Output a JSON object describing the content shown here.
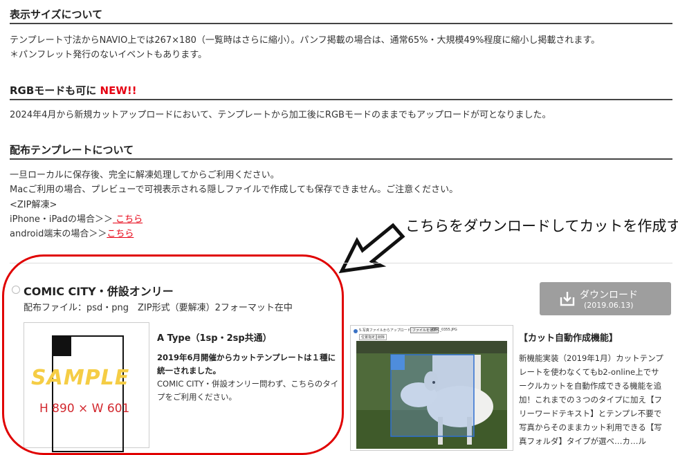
{
  "sections": {
    "size": {
      "heading": "表示サイズについて",
      "line1": "テンプレート寸法からNAVIO上では267×180（一覧時はさらに縮小）。パンフ掲載の場合は、通常65%・大規模49%程度に縮小し掲載されます。",
      "line2": "＊パンフレット発行のないイベントもあります。"
    },
    "rgb": {
      "heading": "RGBモードも可に",
      "badge": "NEW!!",
      "line1": "2024年4月から新規カットアップロードにおいて、テンプレートから加工後にRGBモードのままでもアップロードが可となりました。"
    },
    "template": {
      "heading": "配布テンプレートについて",
      "line1": "一旦ローカルに保存後、完全に解凍処理してからご利用ください。",
      "line2": "Macご利用の場合、プレビューで可視表示される隠しファイルで作成しても保存できません。ご注意ください。",
      "line3": "<ZIP解凍>",
      "iphone_label": "iPhone・iPadの場合＞＞",
      "iphone_link": " こちら",
      "android_label": "android端末の場合＞＞",
      "android_link": "こちら"
    }
  },
  "annotation": {
    "text": "こちらをダウンロードしてカットを作成する",
    "circle_color": "#e00000"
  },
  "event": {
    "title": "COMIC CITY・併設オンリー",
    "files": "配布ファイル：psd・png　ZIP形式（要解凍）2フォーマット在中",
    "download_label": "ダウンロード",
    "download_date": "(2019.06.13)",
    "sample_word": "SAMPLE",
    "sample_size": "H 890 × W 601",
    "type_title": "A Type（1sp・2sp共通）",
    "type_bold": "2019年6月開催からカットテンプレートは１種に統一されました。",
    "type_body": "COMIC CITY・併設オンリー問わず、こちらのタイプをご利用ください。",
    "shot_caption": "5.写真ファイルからアップロードする",
    "shot_button": "ファイルを選択",
    "shot_filename": "DSC_0355.JPG",
    "shot_tab1": "位置指定",
    "shot_tab2": "削除",
    "auto_title": "【カット自動作成機能】",
    "auto_lines": [
      "新機能実装（2019年1月）カットテンプ",
      "レートを使わなくてもb2-online上でサ",
      "ークルカットを自動作成できる機能を追",
      "加！これまでの３つのタイプに加え【フ",
      "リーワードテキスト】とテンプレ不要で",
      "写真からそのままカット利用できる【写",
      "真フォルダ】タイプが選べ…カ…ル"
    ]
  },
  "colors": {
    "accent_red": "#e60012",
    "button_gray": "#9e9e9e"
  }
}
